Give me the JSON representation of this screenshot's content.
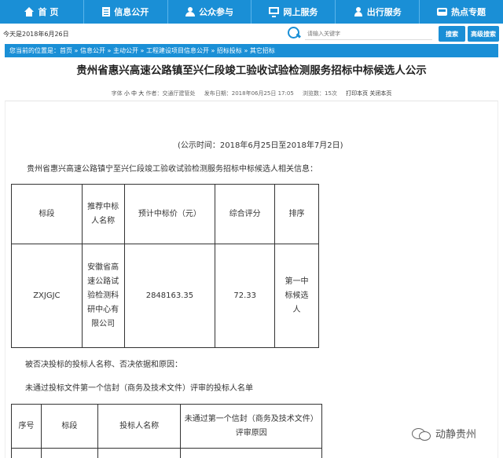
{
  "nav": {
    "items": [
      {
        "label": "首 页",
        "icon": "home-icon"
      },
      {
        "label": "信息公开",
        "icon": "document-icon"
      },
      {
        "label": "公众参与",
        "icon": "people-icon"
      },
      {
        "label": "网上服务",
        "icon": "monitor-icon"
      },
      {
        "label": "出行服务",
        "icon": "service-icon"
      },
      {
        "label": "热点专题",
        "icon": "bus-icon"
      }
    ]
  },
  "header": {
    "today": "今天是2018年6月26日",
    "search_placeholder": "请输入关键字",
    "search_button": "搜索",
    "advanced_button": "高级搜索"
  },
  "breadcrumb": {
    "text": "您当前的位置是：首页 » 信息公开 » 主动公开 » 工程建设项目信息公开 » 招标投标 » 其它招标"
  },
  "article": {
    "title": "贵州省惠兴高速公路镇至兴仁段竣工验收试验检测服务招标中标候选人公示",
    "meta": {
      "font_label": "字体",
      "font_small": "小",
      "font_medium": "中",
      "font_large": "大",
      "author": "作者：交通厅建管处",
      "date": "发布日期：2018年06月25日 17:05",
      "views": "浏览数：15次",
      "print": "打印本页",
      "close": "关闭本页"
    },
    "notice_time": "(公示时间：2018年6月25日至2018年7月2日)",
    "intro": "贵州省惠兴高速公路镇宁至兴仁段竣工验收试验检测服务招标中标候选人相关信息：",
    "table1": {
      "headers": [
        "标段",
        "推荐中标人名称",
        "预计中标价（元）",
        "综合评分",
        "排序"
      ],
      "row": [
        "ZXJGJC",
        "安徽省高速公路试验检测科研中心有限公司",
        "2848163.35",
        "72.33",
        "第一中标候选人"
      ]
    },
    "rejected_intro": "被否决投标的投标人名称、否决依据和原因：",
    "failed_intro": "未通过投标文件第一个信封（商务及技术文件）评审的投标人名单",
    "table2": {
      "headers": [
        "序号",
        "标段",
        "投标人名称",
        "未通过第一个信封（商务及技术文件）评审原因"
      ]
    }
  },
  "watermark": {
    "text": "动静贵州"
  }
}
